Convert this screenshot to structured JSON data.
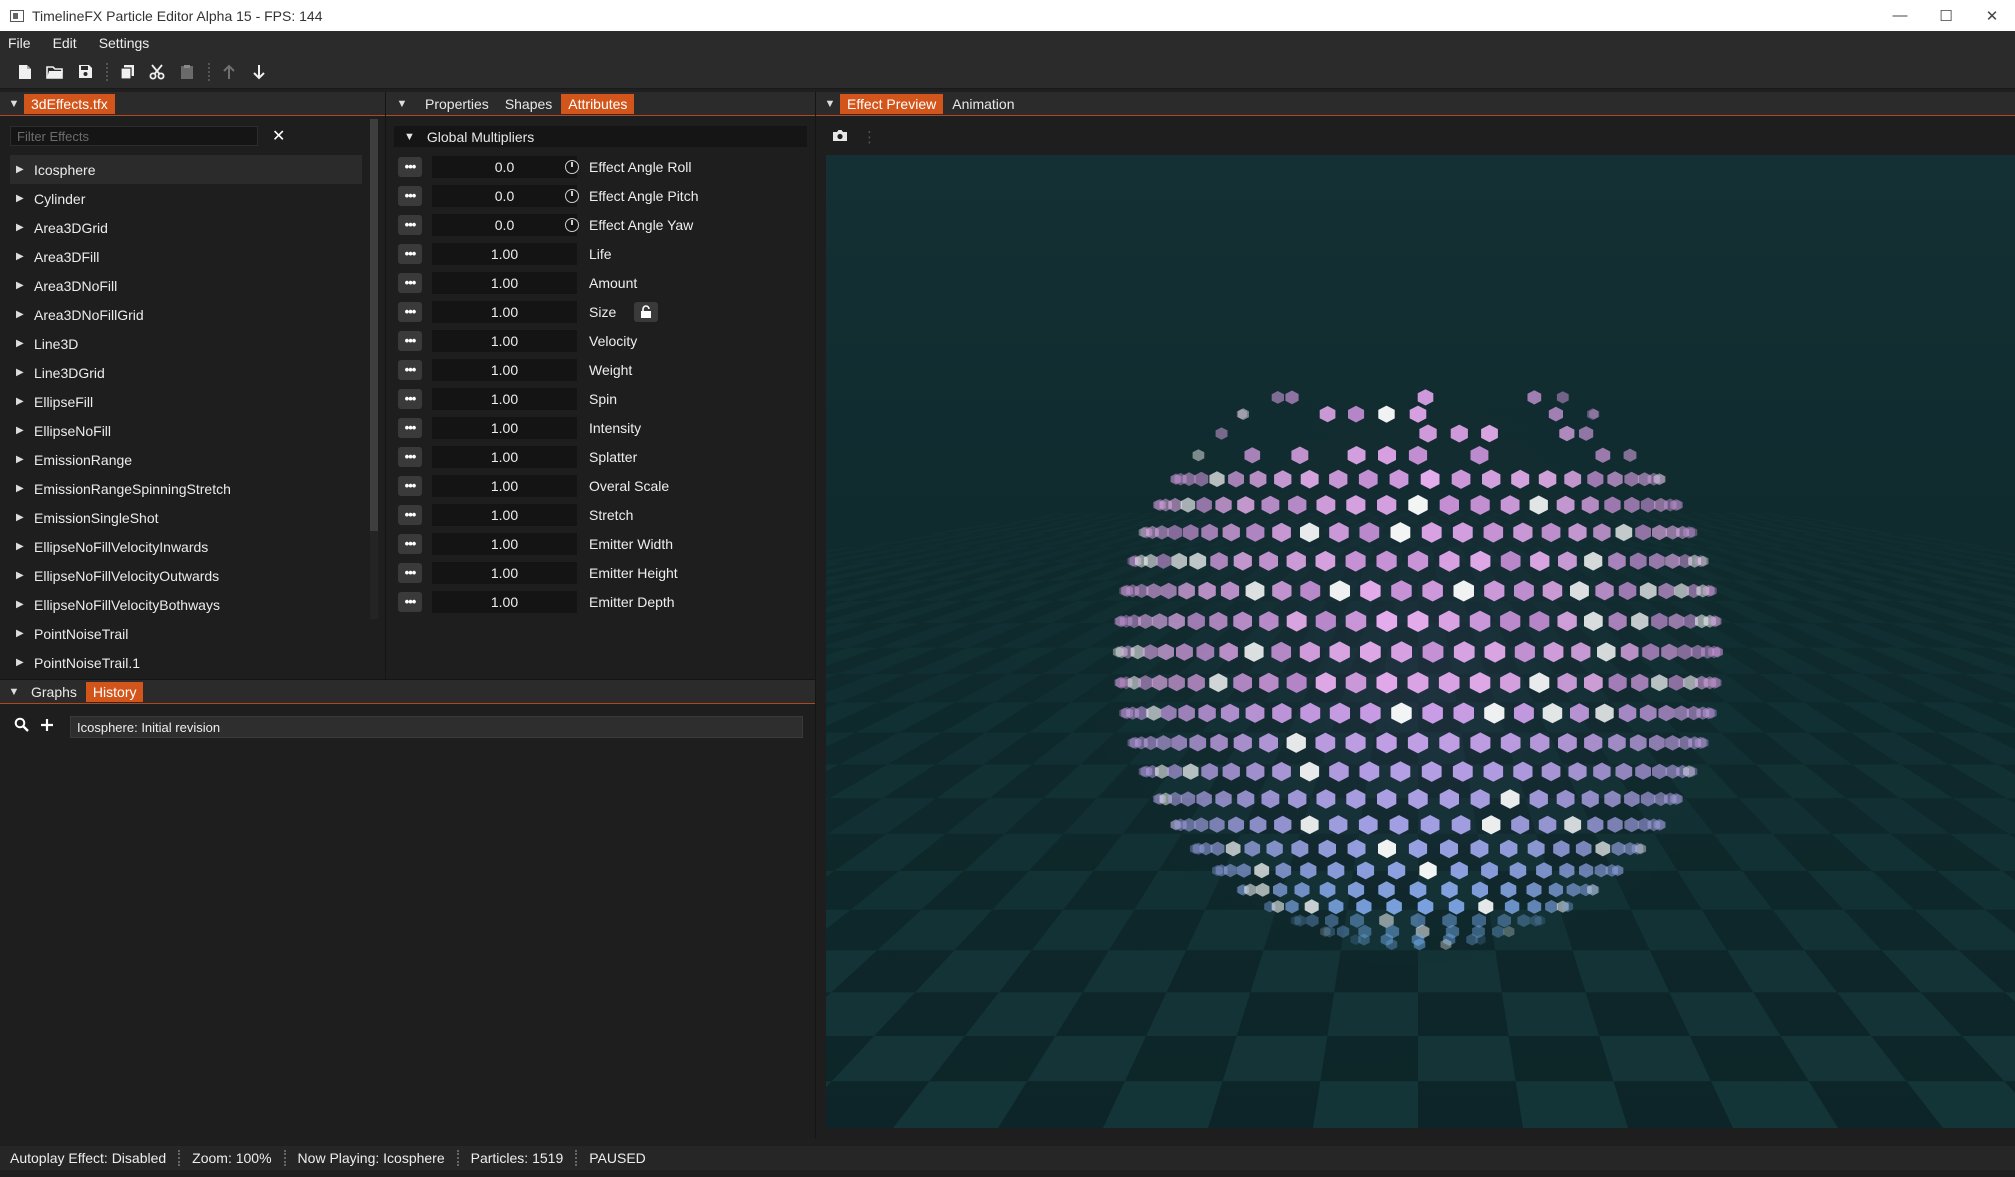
{
  "window": {
    "title": "TimelineFX Particle Editor Alpha 15 - FPS: 144",
    "controls": [
      "—",
      "☐",
      "✕"
    ]
  },
  "menu": [
    "File",
    "Edit",
    "Settings"
  ],
  "toolbar": {
    "icons": [
      "new-file-icon",
      "open-folder-icon",
      "save-icon",
      "copy-icon",
      "cut-icon",
      "paste-icon",
      "move-up-icon",
      "move-down-icon"
    ]
  },
  "effects_panel": {
    "tab": "3dEffects.tfx",
    "filter_placeholder": "Filter Effects",
    "clear_glyph": "✕",
    "items": [
      "Icosphere",
      "Cylinder",
      "Area3DGrid",
      "Area3DFill",
      "Area3DNoFill",
      "Area3DNoFillGrid",
      "Line3D",
      "Line3DGrid",
      "EllipseFill",
      "EllipseNoFill",
      "EmissionRange",
      "EmissionRangeSpinningStretch",
      "EmissionSingleShot",
      "EllipseNoFillVelocityInwards",
      "EllipseNoFillVelocityOutwards",
      "EllipseNoFillVelocityBothways",
      "PointNoiseTrail",
      "PointNoiseTrail.1"
    ],
    "selected": "Icosphere"
  },
  "attributes_panel": {
    "tabs": [
      "Properties",
      "Shapes",
      "Attributes"
    ],
    "active_tab": "Attributes",
    "section": "Global Multipliers",
    "rows": [
      {
        "value": "0.0",
        "label": "Effect Angle Roll"
      },
      {
        "value": "0.0",
        "label": "Effect Angle Pitch"
      },
      {
        "value": "0.0",
        "label": "Effect Angle Yaw"
      },
      {
        "value": "1.00",
        "label": "Life"
      },
      {
        "value": "1.00",
        "label": "Amount"
      },
      {
        "value": "1.00",
        "label": "Size"
      },
      {
        "value": "1.00",
        "label": "Velocity"
      },
      {
        "value": "1.00",
        "label": "Weight"
      },
      {
        "value": "1.00",
        "label": "Spin"
      },
      {
        "value": "1.00",
        "label": "Intensity"
      },
      {
        "value": "1.00",
        "label": "Splatter"
      },
      {
        "value": "1.00",
        "label": "Overal Scale"
      },
      {
        "value": "1.00",
        "label": "Stretch"
      },
      {
        "value": "1.00",
        "label": "Emitter Width"
      },
      {
        "value": "1.00",
        "label": "Emitter Height"
      },
      {
        "value": "1.00",
        "label": "Emitter Depth"
      }
    ]
  },
  "history_panel": {
    "tabs": [
      "Graphs",
      "History"
    ],
    "active_tab": "History",
    "entry": "Icosphere: Initial revision"
  },
  "preview_panel": {
    "tabs": [
      "Effect Preview",
      "Animation"
    ],
    "active_tab": "Effect Preview"
  },
  "status": [
    "Autoplay Effect: Disabled",
    "Zoom: 100%",
    "Now Playing: Icosphere",
    "Particles: 1519",
    "PAUSED"
  ],
  "colors": {
    "accent": "#d2561b",
    "background": "#1e1e1e",
    "preview_bg": "#0f2a2d",
    "particle_pink": "#e7a2f0",
    "particle_blue": "#6fa8e6"
  }
}
